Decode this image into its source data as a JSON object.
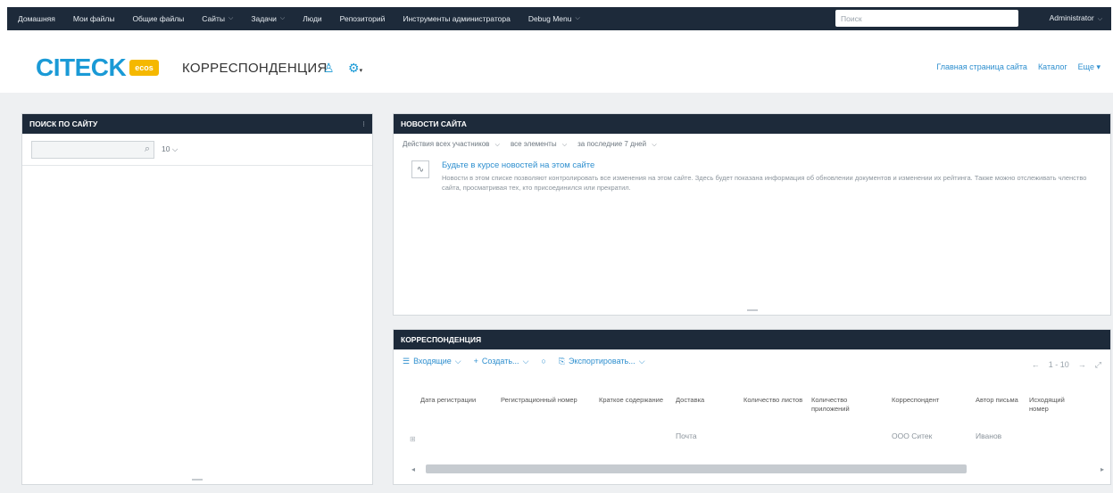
{
  "nav": {
    "items": [
      {
        "label": "Домашняя",
        "caret": false
      },
      {
        "label": "Мои файлы",
        "caret": false
      },
      {
        "label": "Общие файлы",
        "caret": false
      },
      {
        "label": "Сайты",
        "caret": true
      },
      {
        "label": "Задачи",
        "caret": true
      },
      {
        "label": "Люди",
        "caret": false
      },
      {
        "label": "Репозиторий",
        "caret": false
      },
      {
        "label": "Инструменты администратора",
        "caret": false
      },
      {
        "label": "Debug Menu",
        "caret": true
      }
    ],
    "search_placeholder": "Поиск",
    "user": "Administrator"
  },
  "header": {
    "logo_text": "CITECK",
    "logo_badge": "ecos",
    "site_title": "КОРРЕСПОНДЕНЦИЯ",
    "links": [
      "Главная страница сайта",
      "Каталог",
      "Еще"
    ]
  },
  "site_search": {
    "title": "Поиск по сайту",
    "count": "10"
  },
  "news": {
    "title": "Новости сайта",
    "filters": [
      "Действия всех участников",
      "все элементы",
      "за последние 7 дней"
    ],
    "item_title": "Будьте в курсе новостей на этом сайте",
    "item_desc": "Новости в этом списке позволяют контролировать все изменения на этом сайте. Здесь будет показана информация об обновлении документов и изменении их рейтинга. Также можно отслеживать членство сайта, просматривая тех, кто присоединился или прекратил."
  },
  "correspondence": {
    "title": "Корреспонденция",
    "toolbar": [
      "Входящие",
      "Создать...",
      "Экспортировать..."
    ],
    "pager": "1 - 10",
    "columns": [
      "Дата регистрации",
      "Регистрационный номер",
      "Краткое содержание",
      "Доставка",
      "Количество листов",
      "Количество приложений",
      "Корреспондент",
      "Автор письма",
      "Исходящий номер"
    ],
    "rows": [
      [
        "",
        "",
        "",
        "Почта",
        "",
        "",
        "ООО Ситек",
        "Иванов",
        ""
      ]
    ]
  },
  "colors": {
    "nav_bg": "#1d2a3a",
    "accent": "#1a9ad6",
    "badge": "#f5b800",
    "link": "#2e8fcf"
  }
}
